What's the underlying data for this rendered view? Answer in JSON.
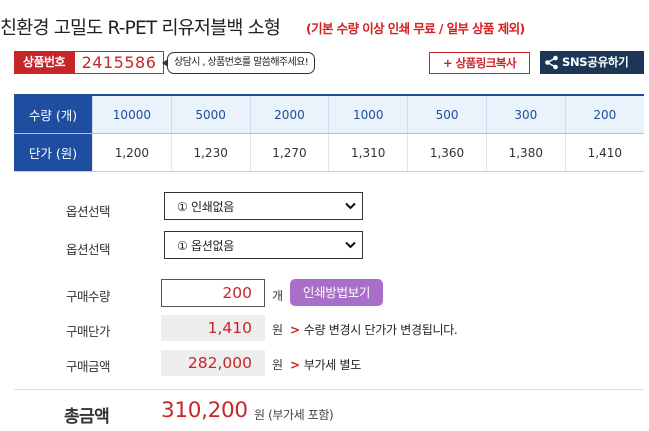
{
  "product": {
    "title": "친환경 고밀도 R-PET 리유저블백 소형",
    "title_note": "(기본 수량 이상 인쇄 무료 / 일부 상품 제외)"
  },
  "code_row": {
    "label": "상품번호",
    "code": "2415586",
    "bubble": "상담시 , 상품번호를 말씀해주세요!",
    "copy_link": "+ 상품링크복사",
    "sns_share": "SNS공유하기"
  },
  "price_table": {
    "qty_header": "수량 (개)",
    "unit_header": "단가 (원)",
    "quantities": [
      "10000",
      "5000",
      "2000",
      "1000",
      "500",
      "300",
      "200"
    ],
    "unit_prices": [
      "1,200",
      "1,230",
      "1,270",
      "1,310",
      "1,360",
      "1,380",
      "1,410"
    ]
  },
  "options": [
    {
      "label": "옵션선택",
      "selected": "① 인쇄없음"
    },
    {
      "label": "옵션선택",
      "selected": "① 옵션없음"
    }
  ],
  "order": {
    "qty_label": "구매수량",
    "qty_value": "200",
    "qty_unit": "개",
    "print_method_button": "인쇄방법보기",
    "unit_price_label": "구매단가",
    "unit_price_value": "1,410",
    "currency_unit": "원",
    "unit_price_note": "수량 변경시 단가가 변경됩니다.",
    "amount_label": "구매금액",
    "amount_value": "282,000",
    "amount_note": "부가세 별도"
  },
  "total": {
    "label": "총금액",
    "value": "310,200",
    "unit": "원",
    "vat_note": "(부가세 포함)"
  },
  "colors": {
    "brand_red": "#c8252a",
    "table_blue": "#1f4ea0",
    "sns_navy": "#1c3756",
    "print_button_purple": "#a96ec8"
  }
}
